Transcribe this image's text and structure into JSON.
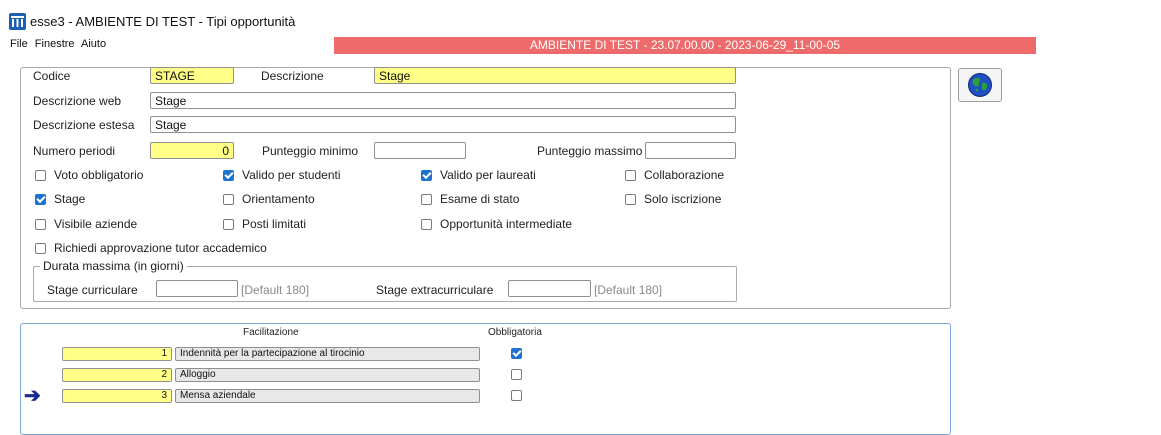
{
  "window": {
    "title": "esse3 - AMBIENTE DI TEST - Tipi opportunità",
    "app_icon": "columns-app-icon"
  },
  "menu": [
    "File",
    "Finestre",
    "Aiuto"
  ],
  "env_banner": {
    "text": "AMBIENTE DI TEST - 23.07.00.00 - 2023-06-29_11-00-05",
    "color": "#ef6b6b"
  },
  "form": {
    "codice_label": "Codice",
    "codice_value": "STAGE",
    "descrizione_label": "Descrizione",
    "descrizione_value": "Stage",
    "descrizione_web_label": "Descrizione web",
    "descrizione_web_value": "Stage",
    "descrizione_estesa_label": "Descrizione estesa",
    "descrizione_estesa_value": "Stage",
    "numero_periodi_label": "Numero periodi",
    "numero_periodi_value": "0",
    "punteggio_minimo_label": "Punteggio minimo",
    "punteggio_minimo_value": "",
    "punteggio_massimo_label": "Punteggio massimo",
    "punteggio_massimo_value": ""
  },
  "checkboxes": {
    "voto_obbligatorio": {
      "label": "Voto obbligatorio",
      "checked": false
    },
    "valido_studenti": {
      "label": "Valido per studenti",
      "checked": true
    },
    "valido_laureati": {
      "label": "Valido per laureati",
      "checked": true
    },
    "collaborazione": {
      "label": "Collaborazione",
      "checked": false
    },
    "stage": {
      "label": "Stage",
      "checked": true
    },
    "orientamento": {
      "label": "Orientamento",
      "checked": false
    },
    "esame_stato": {
      "label": "Esame di stato",
      "checked": false
    },
    "solo_iscrizione": {
      "label": "Solo iscrizione",
      "checked": false
    },
    "visibile_aziende": {
      "label": "Visibile aziende",
      "checked": false
    },
    "posti_limitati": {
      "label": "Posti limitati",
      "checked": false
    },
    "opportunita_intermedie": {
      "label": "Opportunità intermediate",
      "checked": false
    },
    "richiedi_approvazione": {
      "label": "Richiedi approvazione tutor accademico",
      "checked": false
    }
  },
  "durata": {
    "legend": "Durata massima (in giorni)",
    "curriculare_label": "Stage curriculare",
    "curriculare_value": "",
    "curriculare_hint": "[Default 180]",
    "extracurriculare_label": "Stage extracurriculare",
    "extracurriculare_value": "",
    "extracurriculare_hint": "[Default 180]"
  },
  "globe_button": {
    "icon": "globe-icon"
  },
  "facilitazioni": {
    "header_facilitazione": "Facilitazione",
    "header_obbligatoria": "Obbligatoria",
    "rows": [
      {
        "num": "1",
        "text": "Indennità per la partecipazione al tirocinio",
        "obbligatoria": true,
        "current": false
      },
      {
        "num": "2",
        "text": "Alloggio",
        "obbligatoria": false,
        "current": false
      },
      {
        "num": "3",
        "text": "Mensa aziendale",
        "obbligatoria": false,
        "current": true
      }
    ]
  },
  "colors": {
    "required_field": "#ffff88",
    "checkbox_on": "#1e73d0",
    "grid_border": "#7aa6d8"
  }
}
